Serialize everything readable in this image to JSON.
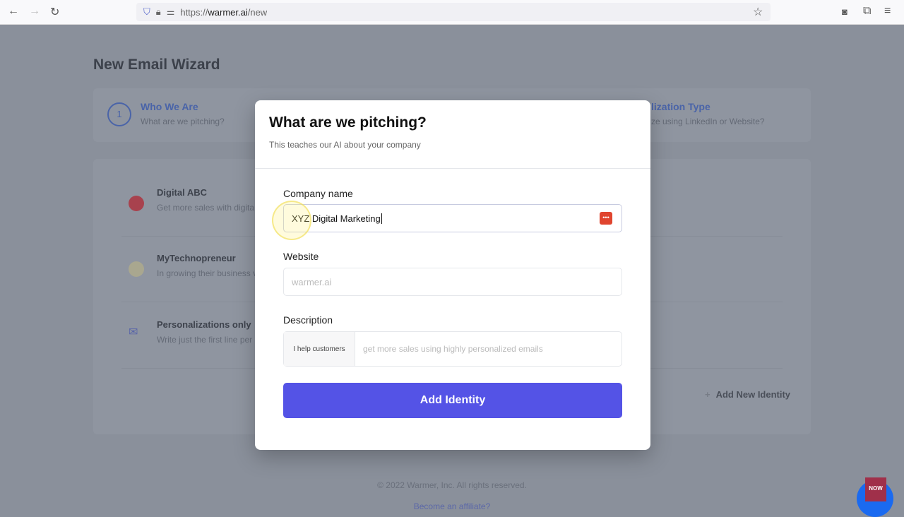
{
  "browser": {
    "url_prefix": "https://",
    "url_domain": "warmer.ai",
    "url_path": "/new",
    "icons": [
      "back-icon",
      "forward-icon",
      "reload-icon",
      "shield-icon",
      "lock-icon",
      "permissions-icon",
      "star-icon",
      "pocket-icon",
      "extensions-icon",
      "menu-icon"
    ]
  },
  "page": {
    "title": "New Email Wizard",
    "steps": [
      {
        "number": "1",
        "title": "Who We Are",
        "subtitle": "What are we pitching?"
      },
      {
        "title": "lization Type",
        "subtitle": "ze using LinkedIn or Website?"
      }
    ],
    "identities": [
      {
        "name": "Digital ABC",
        "description": "Get more sales with digita"
      },
      {
        "name": "MyTechnopreneur",
        "description": "In growing their business v"
      },
      {
        "name": "Personalizations only",
        "description": "Write just the first line per"
      }
    ],
    "add_new": "Add New Identity",
    "footer": {
      "copyright": "© 2022 Warmer, Inc. All rights reserved.",
      "affiliate": "Become an affiliate?"
    }
  },
  "modal": {
    "title": "What are we pitching?",
    "subtitle": "This teaches our AI about your company",
    "company_label": "Company name",
    "company_value": "XYZ Digital Marketing",
    "website_label": "Website",
    "website_placeholder": "warmer.ai",
    "description_label": "Description",
    "description_prefix": "I help customers",
    "description_placeholder": "get more sales using highly personalized emails",
    "submit": "Add Identity"
  },
  "badge": {
    "text": "NOW"
  },
  "colors": {
    "accent": "#5453e6",
    "step": "#2563eb",
    "password_manager": "#e0452f"
  }
}
